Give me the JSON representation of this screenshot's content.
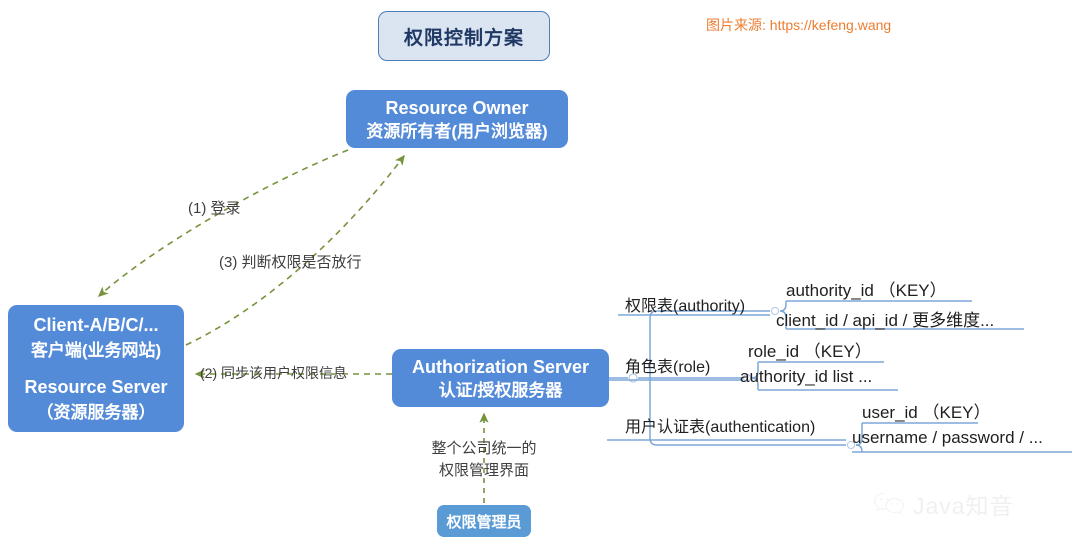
{
  "title": {
    "text": "权限控制方案"
  },
  "watermarks": {
    "source": "图片来源: https://kefeng.wang",
    "brand": "Java知音",
    "brand_icon": "wechat-icon"
  },
  "nodes": {
    "resource_owner": {
      "en": "Resource Owner",
      "cn": "资源所有者(用户浏览器)"
    },
    "client": {
      "en1": "Client-A/B/C/...",
      "cn1": "客户端(业务网站)",
      "en2": "Resource Server",
      "cn2": "（资源服务器）"
    },
    "authorization_server": {
      "en": "Authorization Server",
      "cn": "认证/授权服务器"
    },
    "admin": {
      "label": "权限管理员",
      "caption_line1": "整个公司统一的",
      "caption_line2": "权限管理界面"
    }
  },
  "flows": {
    "step1": "(1) 登录",
    "step2": "(2) 同步该用户权限信息",
    "step3": "(3) 判断权限是否放行"
  },
  "tables": [
    {
      "name": "权限表(authority)",
      "fields": [
        "authority_id （KEY）",
        "client_id / api_id / 更多维度..."
      ]
    },
    {
      "name": "角色表(role)",
      "fields": [
        "role_id （KEY）",
        "authority_id list ..."
      ]
    },
    {
      "name": "用户认证表(authentication)",
      "fields": [
        "user_id （KEY）",
        "username / password / ..."
      ]
    }
  ],
  "colors": {
    "node_blue": "#548bd8",
    "admin_blue": "#5b9bd5",
    "title_fill": "#dbe5f1",
    "title_border": "#4a7ebb",
    "title_text": "#1f3864",
    "flow_arrow": "#77933c",
    "mindmap_line": "#7da7d9",
    "source_text": "#ed7d31"
  }
}
